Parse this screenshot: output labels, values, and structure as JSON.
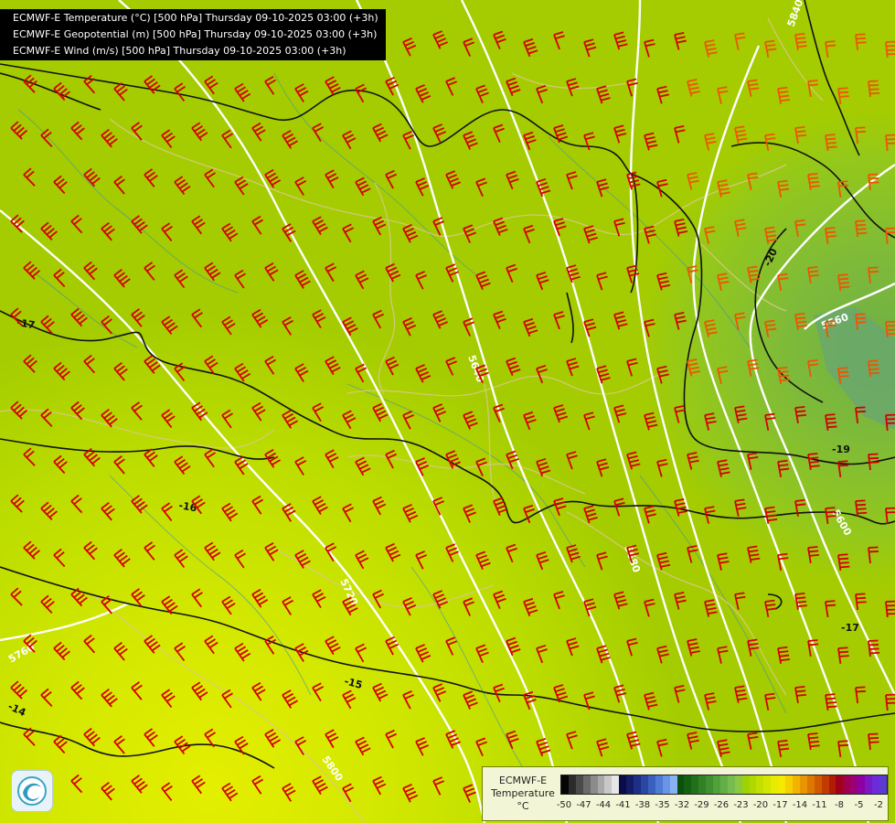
{
  "titles": [
    "ECMWF-E Temperature (°C) [500 hPa] Thursday 09-10-2025 03:00 (+3h)",
    "ECMWF-E Geopotential (m) [500 hPa] Thursday 09-10-2025 03:00 (+3h)",
    "ECMWF-E Wind (m/s) [500 hPa] Thursday 09-10-2025 03:00 (+3h)"
  ],
  "legend": {
    "line1": "ECMWF-E",
    "line2": "Temperature",
    "unit": "°C",
    "tick_labels": [
      "-50",
      "-47",
      "-44",
      "-41",
      "-38",
      "-35",
      "-32",
      "-29",
      "-26",
      "-23",
      "-20",
      "-17",
      "-14",
      "-11",
      "-8",
      "-5",
      "-2"
    ],
    "colors": [
      "#050505",
      "#2b2b2b",
      "#4a4a4a",
      "#6a6a6a",
      "#8b8b8b",
      "#a9a9a9",
      "#c8c8c8",
      "#e6e6e6",
      "#0b0b48",
      "#141c66",
      "#1d2f86",
      "#2a46a4",
      "#3a60bf",
      "#4f7ad6",
      "#6a94e6",
      "#88b1f2",
      "#0a4f0a",
      "#165f12",
      "#23701b",
      "#318025",
      "#419030",
      "#52a03c",
      "#64ae46",
      "#77bc4e",
      "#8ac844",
      "#9ed200",
      "#b0d800",
      "#c2df00",
      "#d4e500",
      "#e6eb00",
      "#f4ea00",
      "#f6d000",
      "#f2b400",
      "#e89600",
      "#dd7700",
      "#d05a00",
      "#c23c00",
      "#b11c00",
      "#a0001c",
      "#a0004a",
      "#9a0078",
      "#8c00a4",
      "#7a18c4",
      "#6a2cd8",
      "#5a3ad0"
    ]
  },
  "contour_labels": {
    "geopotential": [
      "5840",
      "5800",
      "5760",
      "5720",
      "5680",
      "5640",
      "5600",
      "5560"
    ],
    "temperature": [
      "-14",
      "-15",
      "-16",
      "-17",
      "-19",
      "-20",
      "-17"
    ]
  },
  "colors": {
    "wind_barb": "#d40000",
    "wind_barb_strong": "#ee5500",
    "isotherm": "#111111",
    "isohypse": "#ffffff",
    "coast": "#d9c98a",
    "river": "#3f8fae"
  }
}
